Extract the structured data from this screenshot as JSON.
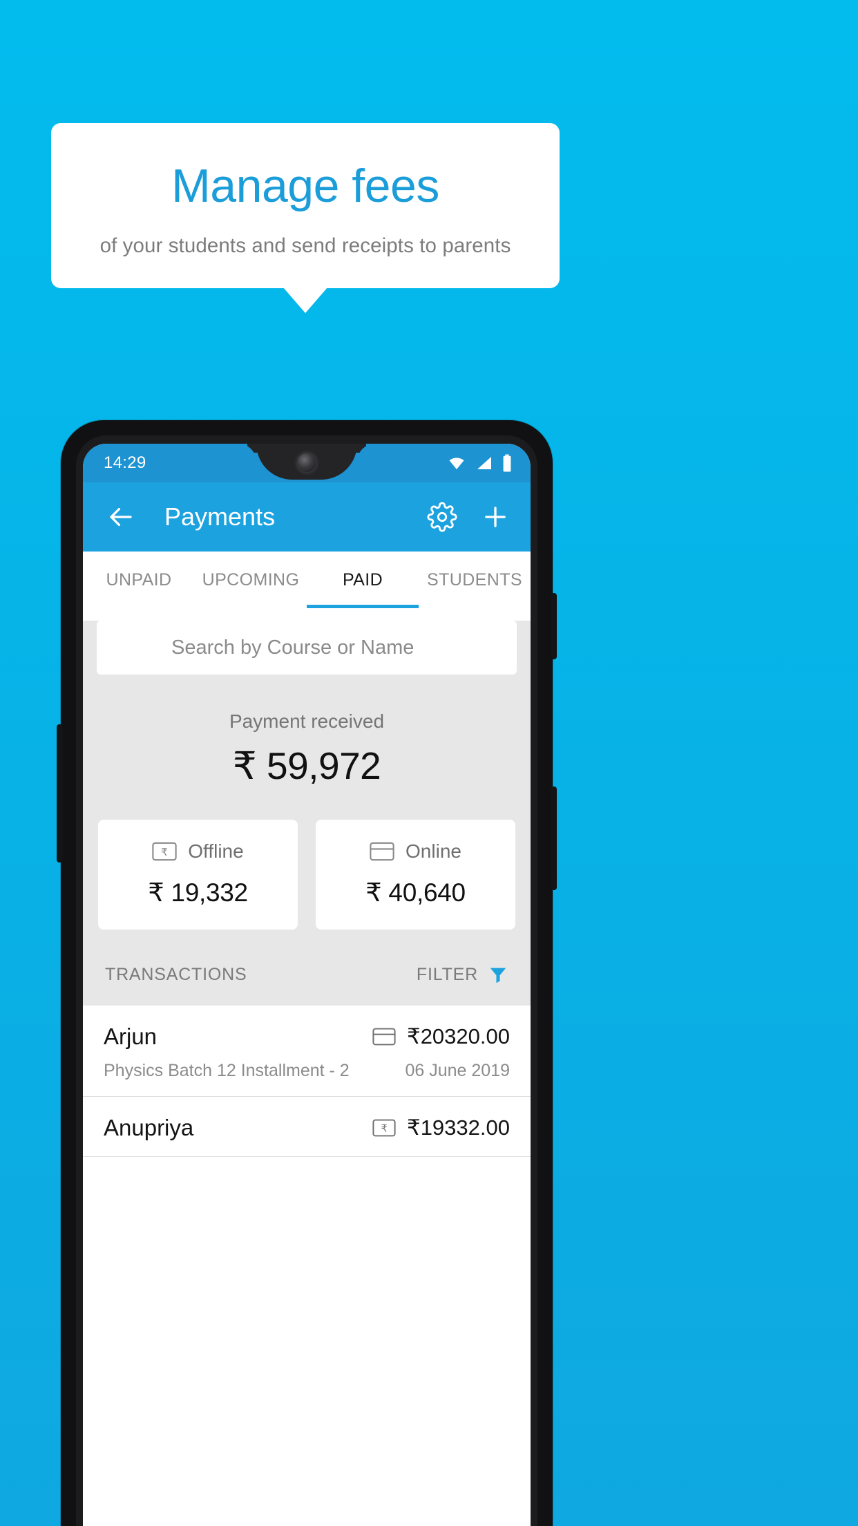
{
  "promo": {
    "title": "Manage fees",
    "subtitle": "of your students and send receipts to parents",
    "accent_color": "#1B9DD9",
    "background_color": "#06B4E8"
  },
  "phone": {
    "status_bar": {
      "time": "14:29",
      "icons": [
        "wifi-icon",
        "signal-icon",
        "battery-icon"
      ]
    },
    "app_bar": {
      "back_icon": "back-arrow-icon",
      "title": "Payments",
      "settings_icon": "gear-icon",
      "add_icon": "plus-icon",
      "color": "#1CA2DF"
    },
    "tabs": [
      {
        "label": "UNPAID",
        "active": false
      },
      {
        "label": "UPCOMING",
        "active": false
      },
      {
        "label": "PAID",
        "active": true
      },
      {
        "label": "STUDENTS",
        "active": false
      }
    ],
    "search": {
      "placeholder": "Search by Course or Name",
      "value": "",
      "icon": "search-icon"
    },
    "summary": {
      "label": "Payment received",
      "amount": "₹ 59,972",
      "cards": [
        {
          "label": "Offline",
          "amount": "₹ 19,332",
          "icon": "banknote-rupee-icon"
        },
        {
          "label": "Online",
          "amount": "₹ 40,640",
          "icon": "credit-card-icon"
        }
      ]
    },
    "transactions_header": {
      "title": "TRANSACTIONS",
      "filter_label": "FILTER",
      "filter_icon": "funnel-icon"
    },
    "transactions": [
      {
        "name": "Arjun",
        "description": "Physics Batch 12 Installment - 2",
        "amount": "₹20320.00",
        "date": "06 June 2019",
        "method_icon": "credit-card-icon"
      },
      {
        "name": "Anupriya",
        "description": "",
        "amount": "₹19332.00",
        "date": "",
        "method_icon": "banknote-rupee-icon"
      }
    ]
  }
}
